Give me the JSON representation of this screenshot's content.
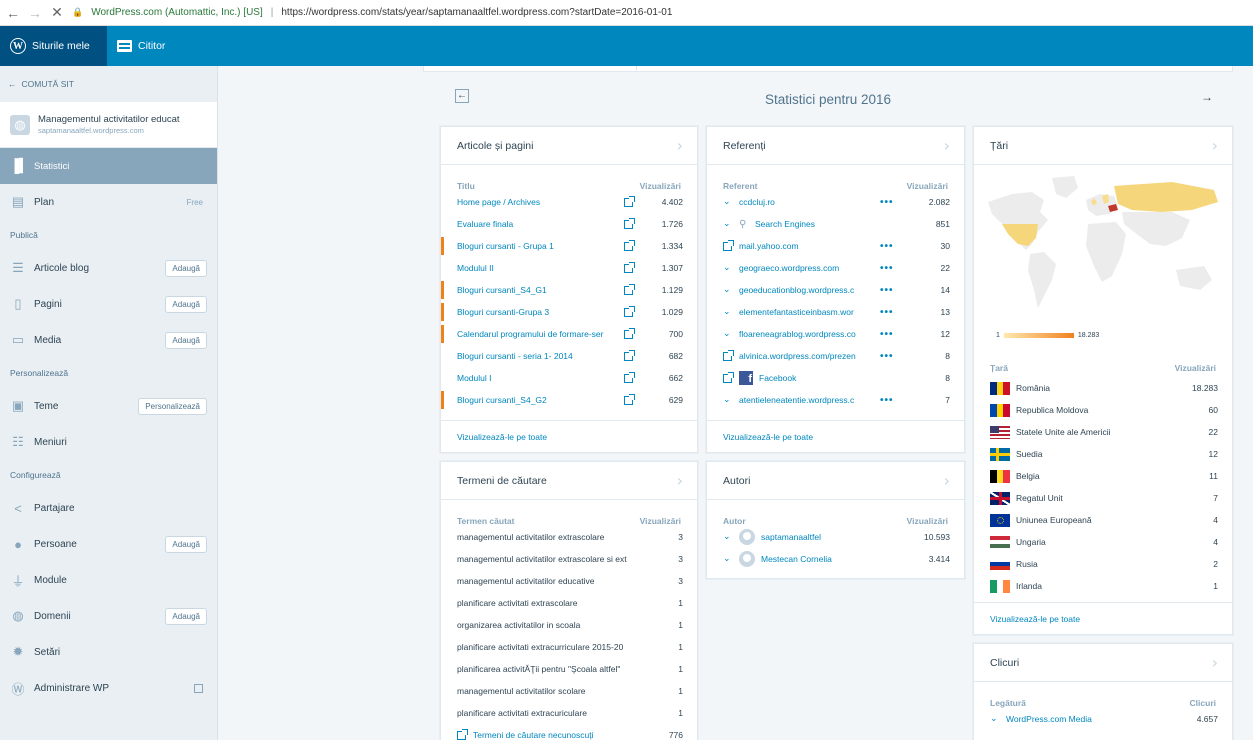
{
  "browser": {
    "site_identity": "WordPress.com (Automattic, Inc.) [US]",
    "url": "https://wordpress.com/stats/year/saptamanaaltfel.wordpress.com?startDate=2016-01-01"
  },
  "masterbar": {
    "my_sites": "Siturile mele",
    "reader": "Cititor"
  },
  "sidebar": {
    "switch_site": "COMUTĂ SIT",
    "site_title": "Managementul activitatilor educat",
    "site_domain": "saptamanaaltfel.wordpress.com",
    "stats": "Statistici",
    "plan": "Plan",
    "plan_badge": "Free",
    "publish_section": "Publică",
    "posts": "Articole blog",
    "pages": "Pagini",
    "media": "Media",
    "add_label": "Adaugă",
    "personalize_section": "Personalizează",
    "themes": "Teme",
    "customize_btn": "Personalizează",
    "menus": "Meniuri",
    "configure_section": "Configurează",
    "sharing": "Partajare",
    "people": "Persoane",
    "plugins": "Module",
    "domains": "Domenii",
    "settings": "Setări",
    "wp_admin": "Administrare WP"
  },
  "header": {
    "title": "Statistici pentru 2016",
    "back": "←",
    "forward": "→"
  },
  "posts_card": {
    "title": "Articole și pagini",
    "col_title": "Titlu",
    "col_views": "Vizualizări",
    "rows": [
      {
        "label": "Home page / Archives",
        "value": "4.402"
      },
      {
        "label": "Evaluare finala",
        "value": "1.726"
      },
      {
        "label": "Bloguri cursanti - Grupa 1",
        "value": "1.334"
      },
      {
        "label": "Modulul II",
        "value": "1.307"
      },
      {
        "label": "Bloguri cursanti_S4_G1",
        "value": "1.129"
      },
      {
        "label": "Bloguri cursanti-Grupa 3",
        "value": "1.029"
      },
      {
        "label": "Calendarul programului de formare-ser",
        "value": "700"
      },
      {
        "label": "Bloguri cursanti - seria 1- 2014",
        "value": "682"
      },
      {
        "label": "Modulul I",
        "value": "662"
      },
      {
        "label": "Bloguri cursanti_S4_G2",
        "value": "629"
      }
    ],
    "footer": "Vizualizează-le pe toate"
  },
  "search_card": {
    "title": "Termeni de căutare",
    "col_title": "Termen căutat",
    "col_views": "Vizualizări",
    "rows": [
      {
        "label": "managementul activitatilor extrascolare",
        "value": "3"
      },
      {
        "label": "managementul activitatilor extrascolare si ext",
        "value": "3"
      },
      {
        "label": "managementul activitatilor educative",
        "value": "3"
      },
      {
        "label": "planificare activitati extrascolare",
        "value": "1"
      },
      {
        "label": "organizarea activitatilor in scoala",
        "value": "1"
      },
      {
        "label": "planificare activitati extracurriculare 2015-20",
        "value": "1"
      },
      {
        "label": "planificarea activitĂŢii pentru \"Şcoala altfel\"",
        "value": "1"
      },
      {
        "label": "managementul activitatilor scolare",
        "value": "1"
      },
      {
        "label": "planificare activitati extracuriculare",
        "value": "1"
      },
      {
        "label": "Termeni de căutare necunoscuți",
        "value": "776"
      }
    ]
  },
  "referrers_card": {
    "title": "Referenți",
    "col_title": "Referent",
    "col_views": "Vizualizări",
    "rows": [
      {
        "label": "ccdcluj.ro",
        "value": "2.082"
      },
      {
        "label": "Search Engines",
        "value": "851"
      },
      {
        "label": "mail.yahoo.com",
        "value": "30"
      },
      {
        "label": "geograeco.wordpress.com",
        "value": "22"
      },
      {
        "label": "geoeducationblog.wordpress.c",
        "value": "14"
      },
      {
        "label": "elementefantasticeinbasm.wor",
        "value": "13"
      },
      {
        "label": "floareneagrablog.wordpress.co",
        "value": "12"
      },
      {
        "label": "alvinica.wordpress.com/prezen",
        "value": "8"
      },
      {
        "label": "Facebook",
        "value": "8"
      },
      {
        "label": "atentieleneatentie.wordpress.c",
        "value": "7"
      }
    ],
    "footer": "Vizualizează-le pe toate"
  },
  "authors_card": {
    "title": "Autori",
    "col_title": "Autor",
    "col_views": "Vizualizări",
    "rows": [
      {
        "label": "saptamanaaltfel",
        "value": "10.593"
      },
      {
        "label": "Mestecan Cornelia",
        "value": "3.414"
      }
    ]
  },
  "countries_card": {
    "title": "Țări",
    "legend_min": "1",
    "legend_max": "18.283",
    "col_title": "Țară",
    "col_views": "Vizualizări",
    "rows": [
      {
        "label": "România",
        "value": "18.283",
        "flag": [
          "#002b7f",
          "#fcd116",
          "#ce1126"
        ],
        "dir": "v"
      },
      {
        "label": "Republica Moldova",
        "value": "60",
        "flag": [
          "#0046ae",
          "#ffd200",
          "#cc092f"
        ],
        "dir": "v"
      },
      {
        "label": "Statele Unite ale Americii",
        "value": "22",
        "flag": [
          "#b22234",
          "#ffffff",
          "#3c3b6e"
        ],
        "dir": "us"
      },
      {
        "label": "Suedia",
        "value": "12",
        "flag": [
          "#006aa7",
          "#fecc00"
        ],
        "dir": "cross"
      },
      {
        "label": "Belgia",
        "value": "11",
        "flag": [
          "#000000",
          "#fdda24",
          "#ef3340"
        ],
        "dir": "v"
      },
      {
        "label": "Regatul Unit",
        "value": "7",
        "flag": [
          "#012169",
          "#ffffff",
          "#c8102e"
        ],
        "dir": "uk"
      },
      {
        "label": "Uniunea Europeană",
        "value": "4",
        "flag": [
          "#003399",
          "#ffcc00"
        ],
        "dir": "eu"
      },
      {
        "label": "Ungaria",
        "value": "4",
        "flag": [
          "#ce2939",
          "#ffffff",
          "#477050"
        ],
        "dir": "h"
      },
      {
        "label": "Rusia",
        "value": "2",
        "flag": [
          "#ffffff",
          "#0039a6",
          "#d52b1e"
        ],
        "dir": "h"
      },
      {
        "label": "Irlanda",
        "value": "1",
        "flag": [
          "#169b62",
          "#ffffff",
          "#ff883e"
        ],
        "dir": "v"
      }
    ],
    "footer": "Vizualizează-le pe toate"
  },
  "clicks_card": {
    "title": "Clicuri",
    "col_title": "Legătură",
    "col_views": "Clicuri",
    "rows": [
      {
        "label": "WordPress.com Media",
        "value": "4.657"
      }
    ]
  },
  "colors": {
    "masterbar": "#0087be",
    "masterbar_active": "#005082",
    "link": "#0087be",
    "highlight": "#f0821e",
    "sidebar_selected": "#87a6bc"
  }
}
